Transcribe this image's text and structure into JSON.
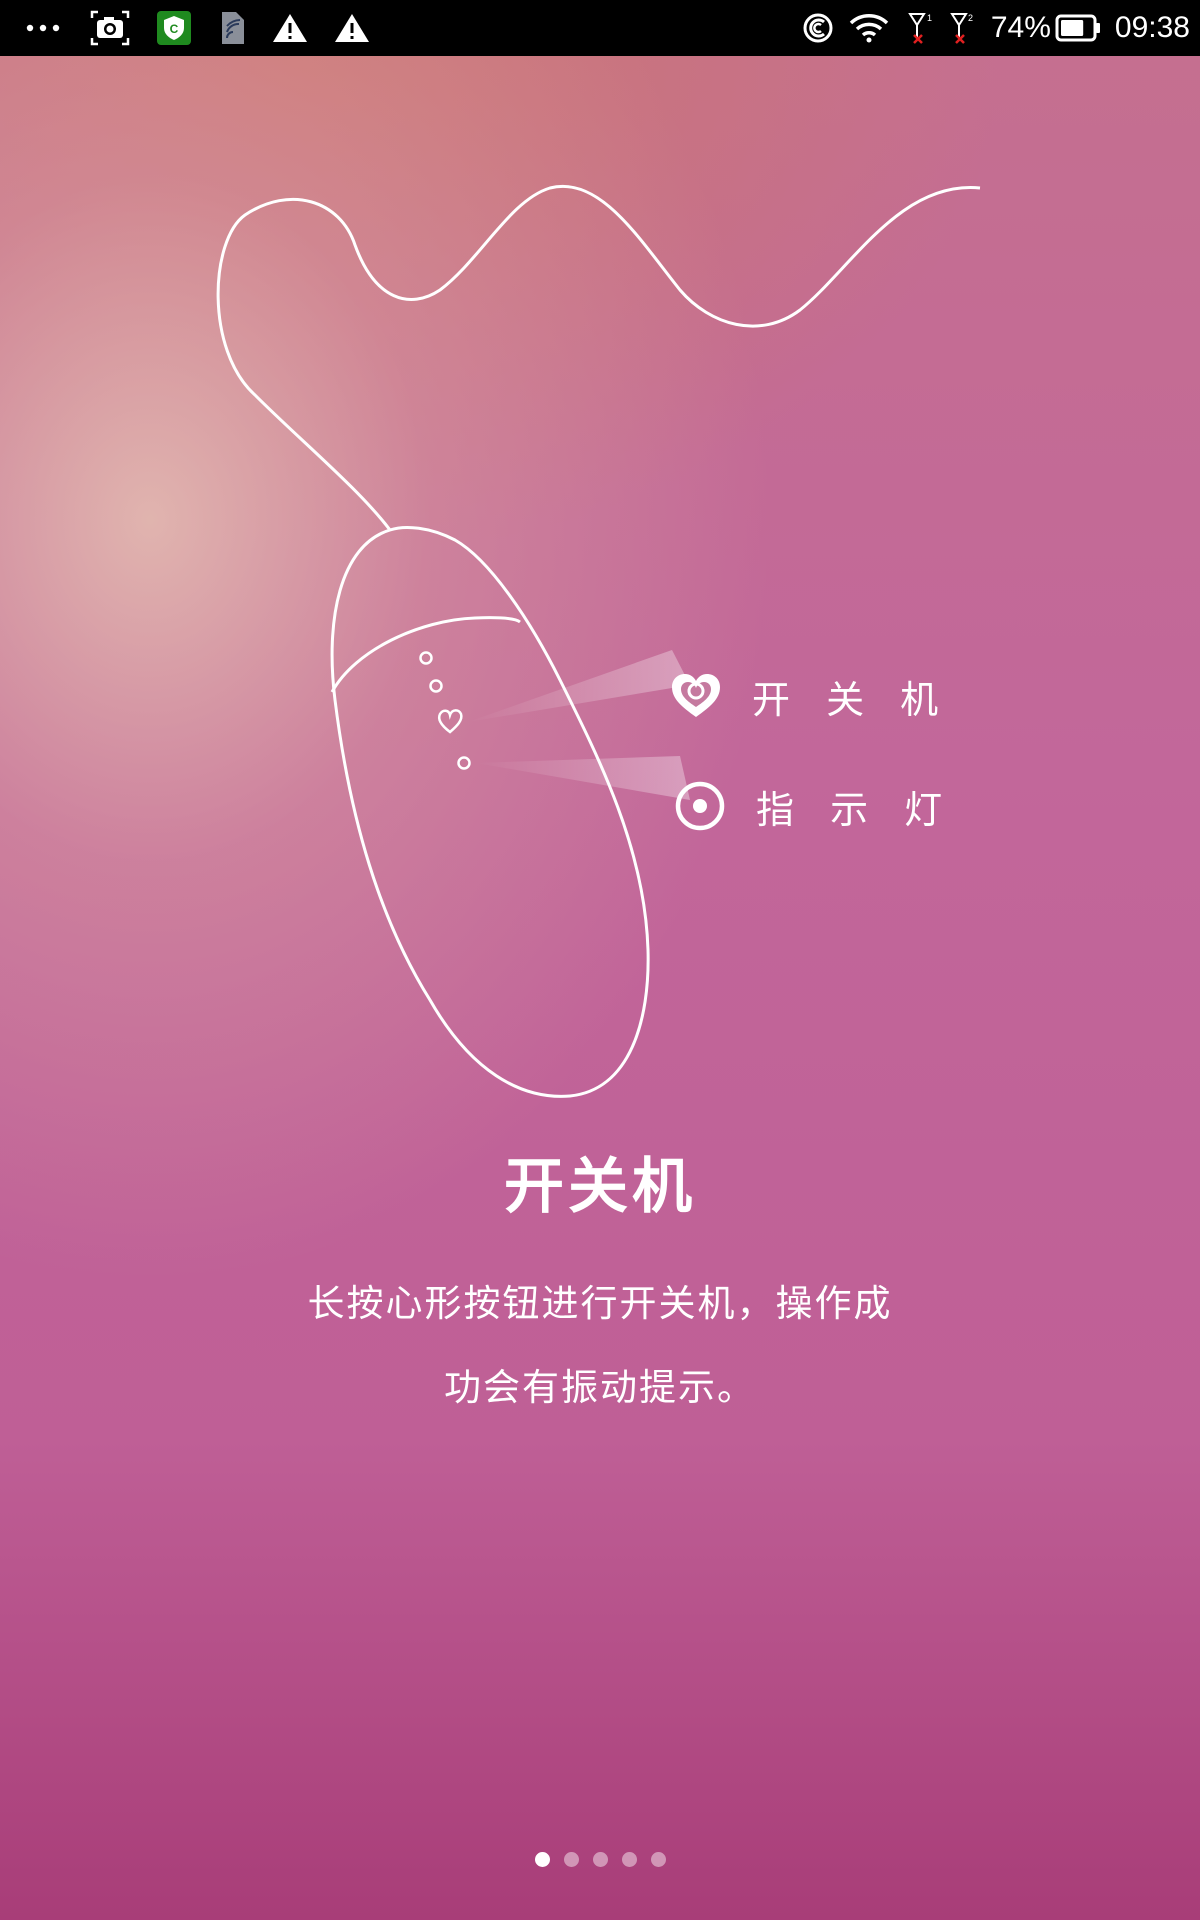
{
  "status_bar": {
    "battery_percent": "74%",
    "battery_level": 0.74,
    "time": "09:38",
    "left_icons": [
      "more-dots-icon",
      "screenshot-icon",
      "security-app-icon",
      "sim-card-icon",
      "warning-icon",
      "warning-icon"
    ],
    "right_icons": [
      "sync-icon",
      "wifi-icon",
      "signal-sim1-no-service-icon",
      "signal-sim2-no-service-icon",
      "battery-icon"
    ]
  },
  "illustration": {
    "callouts": [
      {
        "icon": "heart-button-icon",
        "label": "开 关 机"
      },
      {
        "icon": "indicator-light-icon",
        "label": "指 示 灯"
      }
    ]
  },
  "content": {
    "title": "开关机",
    "description_line1": "长按心形按钮进行开关机，操作成",
    "description_line2": "功会有振动提示。"
  },
  "pager": {
    "total_pages": 5,
    "current_page": 1
  },
  "colors": {
    "background_top": "#c5708f",
    "background_bottom": "#a83d78",
    "foreground": "#ffffff",
    "status_bar": "#000000"
  }
}
